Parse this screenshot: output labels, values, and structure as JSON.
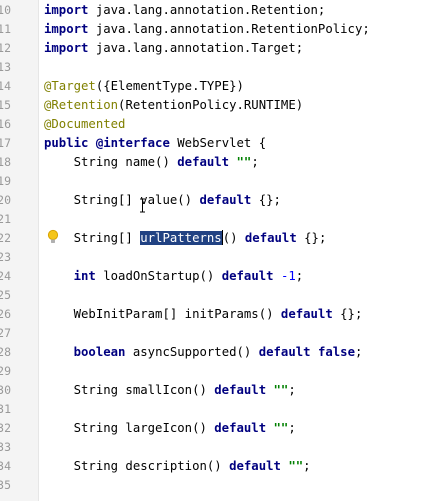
{
  "lines": [
    {
      "num": "10",
      "tokens": [
        {
          "t": "import",
          "c": "kw"
        },
        {
          "t": " java.lang.annotation.Retention;",
          "c": ""
        }
      ]
    },
    {
      "num": "11",
      "tokens": [
        {
          "t": "import",
          "c": "kw"
        },
        {
          "t": " java.lang.annotation.RetentionPolicy;",
          "c": ""
        }
      ]
    },
    {
      "num": "12",
      "tokens": [
        {
          "t": "import",
          "c": "kw"
        },
        {
          "t": " java.lang.annotation.Target;",
          "c": ""
        }
      ]
    },
    {
      "num": "13",
      "tokens": []
    },
    {
      "num": "14",
      "tokens": [
        {
          "t": "@Target",
          "c": "ann"
        },
        {
          "t": "({ElementType.",
          "c": ""
        },
        {
          "t": "TYPE",
          "c": ""
        },
        {
          "t": "})",
          "c": ""
        }
      ]
    },
    {
      "num": "15",
      "tokens": [
        {
          "t": "@Retention",
          "c": "ann"
        },
        {
          "t": "(RetentionPolicy.",
          "c": ""
        },
        {
          "t": "RUNTIME",
          "c": ""
        },
        {
          "t": ")",
          "c": ""
        }
      ]
    },
    {
      "num": "16",
      "tokens": [
        {
          "t": "@Documented",
          "c": "ann"
        }
      ]
    },
    {
      "num": "17",
      "tokens": [
        {
          "t": "public",
          "c": "kw"
        },
        {
          "t": " ",
          "c": ""
        },
        {
          "t": "@interface",
          "c": "kw"
        },
        {
          "t": " WebServlet {",
          "c": ""
        }
      ]
    },
    {
      "num": "18",
      "tokens": [
        {
          "t": "    String name() ",
          "c": ""
        },
        {
          "t": "default",
          "c": "kw"
        },
        {
          "t": " ",
          "c": ""
        },
        {
          "t": "\"\"",
          "c": "str"
        },
        {
          "t": ";",
          "c": ""
        }
      ]
    },
    {
      "num": "19",
      "tokens": []
    },
    {
      "num": "20",
      "tokens": [
        {
          "t": "    String[] value() ",
          "c": ""
        },
        {
          "t": "default",
          "c": "kw"
        },
        {
          "t": " {};",
          "c": ""
        }
      ]
    },
    {
      "num": "21",
      "tokens": []
    },
    {
      "num": "22",
      "tokens": [
        {
          "t": "    String[] ",
          "c": ""
        },
        {
          "t": "urlPatterns",
          "c": "sel"
        },
        {
          "t": "",
          "c": "caret"
        },
        {
          "t": "() ",
          "c": ""
        },
        {
          "t": "default",
          "c": "kw"
        },
        {
          "t": " {};",
          "c": ""
        }
      ]
    },
    {
      "num": "23",
      "tokens": []
    },
    {
      "num": "24",
      "tokens": [
        {
          "t": "    ",
          "c": ""
        },
        {
          "t": "int",
          "c": "kw"
        },
        {
          "t": " loadOnStartup() ",
          "c": ""
        },
        {
          "t": "default",
          "c": "kw"
        },
        {
          "t": " ",
          "c": ""
        },
        {
          "t": "-1",
          "c": "num"
        },
        {
          "t": ";",
          "c": ""
        }
      ]
    },
    {
      "num": "25",
      "tokens": []
    },
    {
      "num": "26",
      "tokens": [
        {
          "t": "    WebInitParam[] initParams() ",
          "c": ""
        },
        {
          "t": "default",
          "c": "kw"
        },
        {
          "t": " {};",
          "c": ""
        }
      ]
    },
    {
      "num": "27",
      "tokens": []
    },
    {
      "num": "28",
      "tokens": [
        {
          "t": "    ",
          "c": ""
        },
        {
          "t": "boolean",
          "c": "kw"
        },
        {
          "t": " asyncSupported() ",
          "c": ""
        },
        {
          "t": "default",
          "c": "kw"
        },
        {
          "t": " ",
          "c": ""
        },
        {
          "t": "false",
          "c": "kw"
        },
        {
          "t": ";",
          "c": ""
        }
      ]
    },
    {
      "num": "29",
      "tokens": []
    },
    {
      "num": "30",
      "tokens": [
        {
          "t": "    String smallIcon() ",
          "c": ""
        },
        {
          "t": "default",
          "c": "kw"
        },
        {
          "t": " ",
          "c": ""
        },
        {
          "t": "\"\"",
          "c": "str"
        },
        {
          "t": ";",
          "c": ""
        }
      ]
    },
    {
      "num": "31",
      "tokens": []
    },
    {
      "num": "32",
      "tokens": [
        {
          "t": "    String largeIcon() ",
          "c": ""
        },
        {
          "t": "default",
          "c": "kw"
        },
        {
          "t": " ",
          "c": ""
        },
        {
          "t": "\"\"",
          "c": "str"
        },
        {
          "t": ";",
          "c": ""
        }
      ]
    },
    {
      "num": "33",
      "tokens": []
    },
    {
      "num": "34",
      "tokens": [
        {
          "t": "    String description() ",
          "c": ""
        },
        {
          "t": "default",
          "c": "kw"
        },
        {
          "t": " ",
          "c": ""
        },
        {
          "t": "\"\"",
          "c": "str"
        },
        {
          "t": ";",
          "c": ""
        }
      ]
    },
    {
      "num": "35",
      "tokens": []
    }
  ],
  "icons": {
    "intention_bulb": "lightbulb-icon",
    "mouse_cursor": "text-cursor-icon"
  },
  "colors": {
    "keyword": "#000080",
    "annotation": "#808000",
    "string": "#008000",
    "number": "#0000ff",
    "selection": "#214283"
  }
}
